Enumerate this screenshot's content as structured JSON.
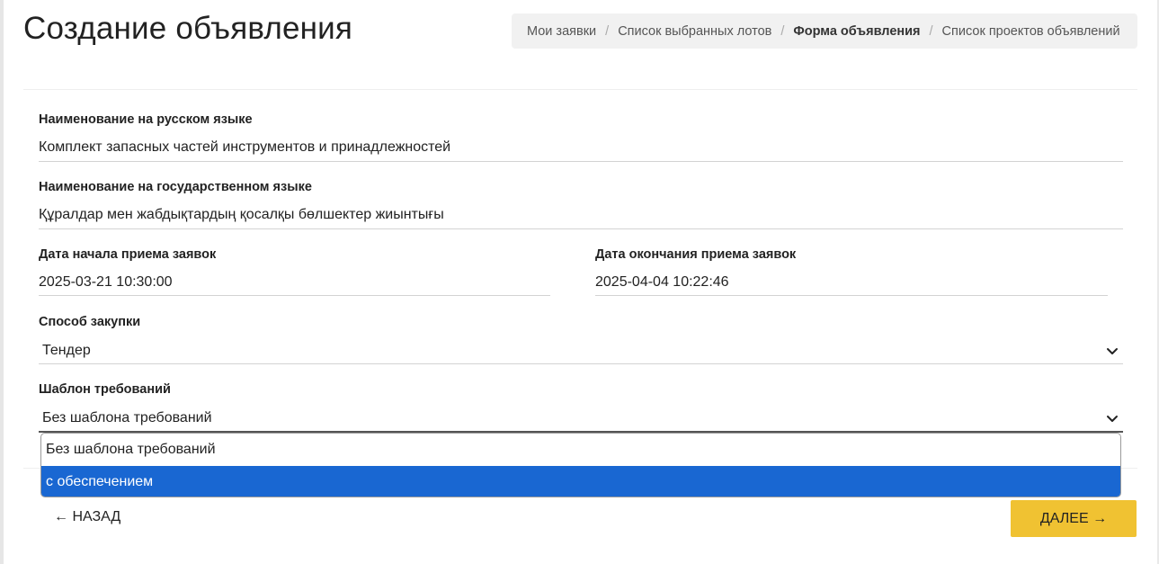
{
  "page": {
    "title": "Создание объявления"
  },
  "breadcrumb": {
    "items": [
      {
        "label": "Мои заявки",
        "active": false
      },
      {
        "label": "Список выбранных лотов",
        "active": false
      },
      {
        "label": "Форма объявления",
        "active": true
      },
      {
        "label": "Список проектов объявлений",
        "active": false
      }
    ],
    "separator": "/"
  },
  "form": {
    "name_ru": {
      "label": "Наименование на русском языке",
      "value": "Комплект запасных частей инструментов и принадлежностей"
    },
    "name_kz": {
      "label": "Наименование на государственном языке",
      "value": "Құралдар мен жабдықтардың қосалқы бөлшектер жиынтығы"
    },
    "start_date": {
      "label": "Дата начала приема заявок",
      "value": "2025-03-21 10:30:00"
    },
    "end_date": {
      "label": "Дата окончания приема заявок",
      "value": "2025-04-04 10:22:46"
    },
    "purchase_method": {
      "label": "Способ закупки",
      "value": "Тендер"
    },
    "template": {
      "label": "Шаблон требований",
      "value": "Без шаблона требований",
      "options": [
        "Без шаблона требований",
        "с обеспечением"
      ],
      "highlighted_index": 1
    }
  },
  "actions": {
    "back": "← НАЗАД",
    "next": "ДАЛЕЕ →",
    "next_color": "#f0c232"
  },
  "colors": {
    "dropdown_highlight": "#1967d2",
    "breadcrumb_bg": "#f1f1f1"
  },
  "icons": {
    "select_arrow": "chevron-down-icon"
  }
}
